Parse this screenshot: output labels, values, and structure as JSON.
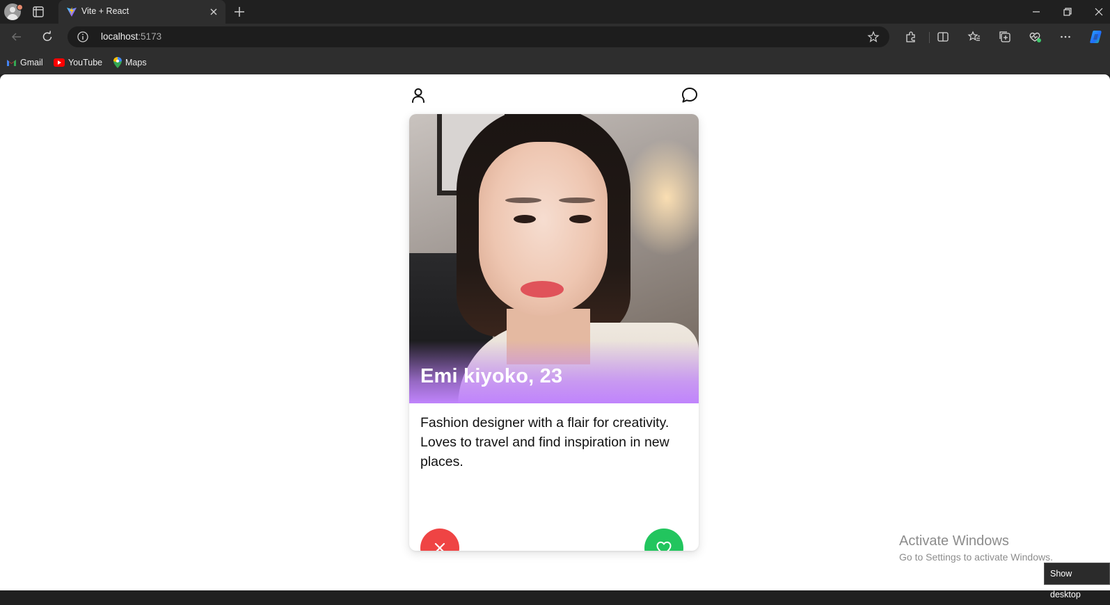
{
  "browser": {
    "tab": {
      "title": "Vite + React"
    },
    "address": {
      "host": "localhost",
      "port": ":5173"
    },
    "bookmarks": [
      {
        "label": "Gmail",
        "icon": "gmail-icon"
      },
      {
        "label": "YouTube",
        "icon": "youtube-icon"
      },
      {
        "label": "Maps",
        "icon": "maps-icon"
      }
    ]
  },
  "app": {
    "header": {
      "left_icon": "user-icon",
      "right_icon": "chat-bubble-icon"
    },
    "profile": {
      "name_age": "Emi kiyoko, 23",
      "bio": "Fashion designer with a flair for creativity. Loves to travel and find inspiration in new places.",
      "photo_icon": "profile-photo"
    },
    "actions": {
      "pass": {
        "icon": "x-icon",
        "color": "#ef4444"
      },
      "like": {
        "icon": "heart-icon",
        "color": "#22c55e"
      }
    },
    "colors": {
      "accent_gradient": "#c084fc"
    }
  },
  "os": {
    "watermark_line1": "Activate Windows",
    "watermark_line2": "Go to Settings to activate Windows.",
    "tooltip": "Show desktop"
  }
}
